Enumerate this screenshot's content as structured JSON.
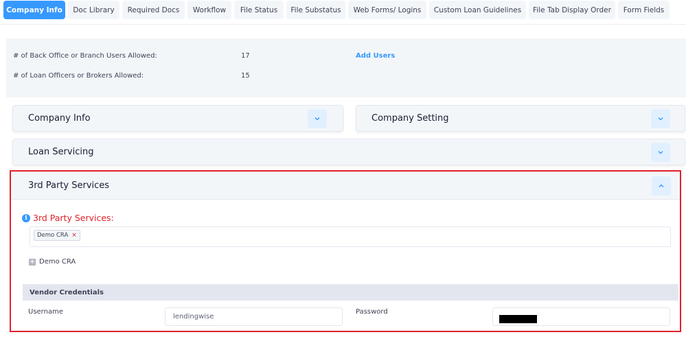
{
  "tabs": [
    {
      "label": "Company Info",
      "active": true
    },
    {
      "label": "Doc Library",
      "active": false
    },
    {
      "label": "Required Docs",
      "active": false
    },
    {
      "label": "Workflow",
      "active": false
    },
    {
      "label": "File Status",
      "active": false
    },
    {
      "label": "File Substatus",
      "active": false
    },
    {
      "label": "Web Forms/ Logins",
      "active": false
    },
    {
      "label": "Custom Loan Guidelines",
      "active": false
    },
    {
      "label": "File Tab Display Order",
      "active": false
    },
    {
      "label": "Form Fields",
      "active": false
    }
  ],
  "summary": {
    "back_office_label": "# of Back Office or Branch Users Allowed:",
    "back_office_value": "17",
    "add_users_link": "Add Users",
    "loan_officers_label": "# of Loan Officers or Brokers Allowed:",
    "loan_officers_value": "15"
  },
  "sections": {
    "company_info": "Company Info",
    "company_setting": "Company Setting",
    "loan_servicing": "Loan Servicing",
    "third_party": "3rd Party Services"
  },
  "third_party": {
    "field_label": "3rd Party Services:",
    "selected_chip": "Demo CRA",
    "chip_remove": "×",
    "tree_item": "Demo CRA",
    "vendor_credentials": "Vendor Credentials",
    "username_label": "Username",
    "username_value": "lendingwise",
    "password_label": "Password"
  },
  "colors": {
    "accent": "#3699ff",
    "highlight_border": "#e0202a",
    "panel_bg": "#f3f6f9"
  },
  "icons": {
    "collapsed": "chevron-down-icon",
    "expanded": "chevron-up-icon",
    "info": "info-icon",
    "expand_tree": "plus-icon"
  }
}
